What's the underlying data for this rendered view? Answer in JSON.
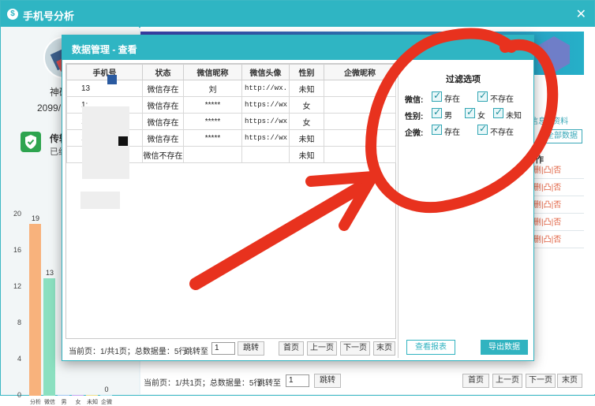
{
  "app": {
    "title": "手机号分析",
    "logo_glyph": "$",
    "close_glyph": "✕"
  },
  "left": {
    "name": "神码",
    "date": "2099/",
    "transfer_label": "传输",
    "transfer_sub": "已统"
  },
  "chart_data": {
    "type": "bar",
    "categories": [
      "分析",
      "微信",
      "男",
      "女",
      "未知",
      "企微"
    ],
    "values": [
      19,
      13,
      0,
      0,
      0,
      0
    ],
    "value_labels": [
      "19",
      "13",
      "",
      "",
      "",
      "0"
    ],
    "yticks": [
      "20",
      "16",
      "12",
      "8",
      "4",
      "0"
    ],
    "ylim": [
      0,
      20
    ],
    "colors": [
      "#f8b27c",
      "#8be0c0",
      "#a6c8f2",
      "#c7a6f2",
      "#f2e08a",
      "#b3e6f2"
    ]
  },
  "right": {
    "links": "信息 | 资料",
    "all_data_button": "全部数据",
    "column_header": "作",
    "row_actions": "删|凸|否",
    "footer": {
      "page_info": "当前页：1/共1页；总数据量：5行",
      "jump_label": "跳转至",
      "jump_value": "1",
      "jump_button": "跳转",
      "first": "首页",
      "prev": "上一页",
      "next": "下一页",
      "last": "末页"
    }
  },
  "modal": {
    "title": "数据管理 - 查看",
    "close_glyph": "✕",
    "columns": [
      "手机号",
      "状态",
      "微信昵称",
      "微信头像",
      "性别",
      "企微昵称"
    ],
    "rows": [
      {
        "phone": "13",
        "status": "微信存在",
        "nickname": "刘",
        "avatar": "http://wx.···",
        "gender": "未知",
        "wework": ""
      },
      {
        "phone": "1:",
        "status": "微信存在",
        "nickname": "*****",
        "avatar": "https://wx···",
        "gender": "女",
        "wework": ""
      },
      {
        "phone": "1:",
        "status": "微信存在",
        "nickname": "*****",
        "avatar": "https://wx···",
        "gender": "女",
        "wework": ""
      },
      {
        "phone": "1:",
        "status": "微信存在",
        "nickname": "*****",
        "avatar": "https://wx···",
        "gender": "未知",
        "wework": ""
      },
      {
        "phone": "",
        "status": "微信不存在",
        "nickname": "",
        "avatar": "",
        "gender": "未知",
        "wework": ""
      }
    ],
    "filter": {
      "title": "过滤选项",
      "wechat_label": "微信:",
      "wechat_options": [
        "存在",
        "不存在"
      ],
      "gender_label": "性别:",
      "gender_options": [
        "男",
        "女",
        "未知"
      ],
      "wework_label": "企微:",
      "wework_options": [
        "存在",
        "不存在"
      ]
    },
    "report_button": "查看报表",
    "export_button": "导出数据",
    "footer": {
      "page_info": "当前页：1/共1页；总数据量：5行",
      "jump_label": "跳转至",
      "jump_value": "1",
      "jump_button": "跳转",
      "first": "首页",
      "prev": "上一页",
      "next": "下一页",
      "last": "末页"
    }
  },
  "annotation_color": "#e8321e"
}
